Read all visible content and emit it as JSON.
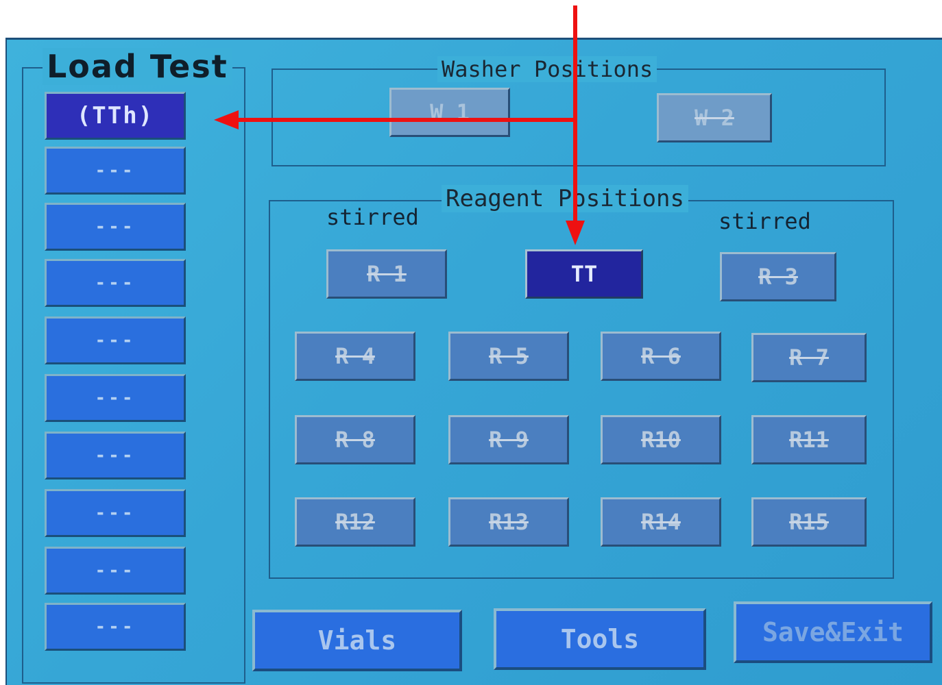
{
  "load_test": {
    "title": "Load Test",
    "slots": [
      "(TTh)",
      "---",
      "---",
      "---",
      "---",
      "---",
      "---",
      "---",
      "---",
      "---"
    ]
  },
  "washer": {
    "title": "Washer Positions",
    "positions": [
      "W 1",
      "W 2"
    ]
  },
  "reagent": {
    "title": "Reagent Positions",
    "stirred_left": "stirred",
    "stirred_right": "stirred",
    "top_row": [
      "R 1",
      "TT",
      "R 3"
    ],
    "grid": [
      "R 4",
      "R 5",
      "R 6",
      "R 7",
      "R 8",
      "R 9",
      "R10",
      "R11",
      "R12",
      "R13",
      "R14",
      "R15"
    ]
  },
  "bottom": {
    "vials": "Vials",
    "tools": "Tools",
    "save_exit": "Save&Exit"
  },
  "colors": {
    "annotation": "#ee1111",
    "screen": "#36a6d6",
    "selected": "#22259e"
  }
}
